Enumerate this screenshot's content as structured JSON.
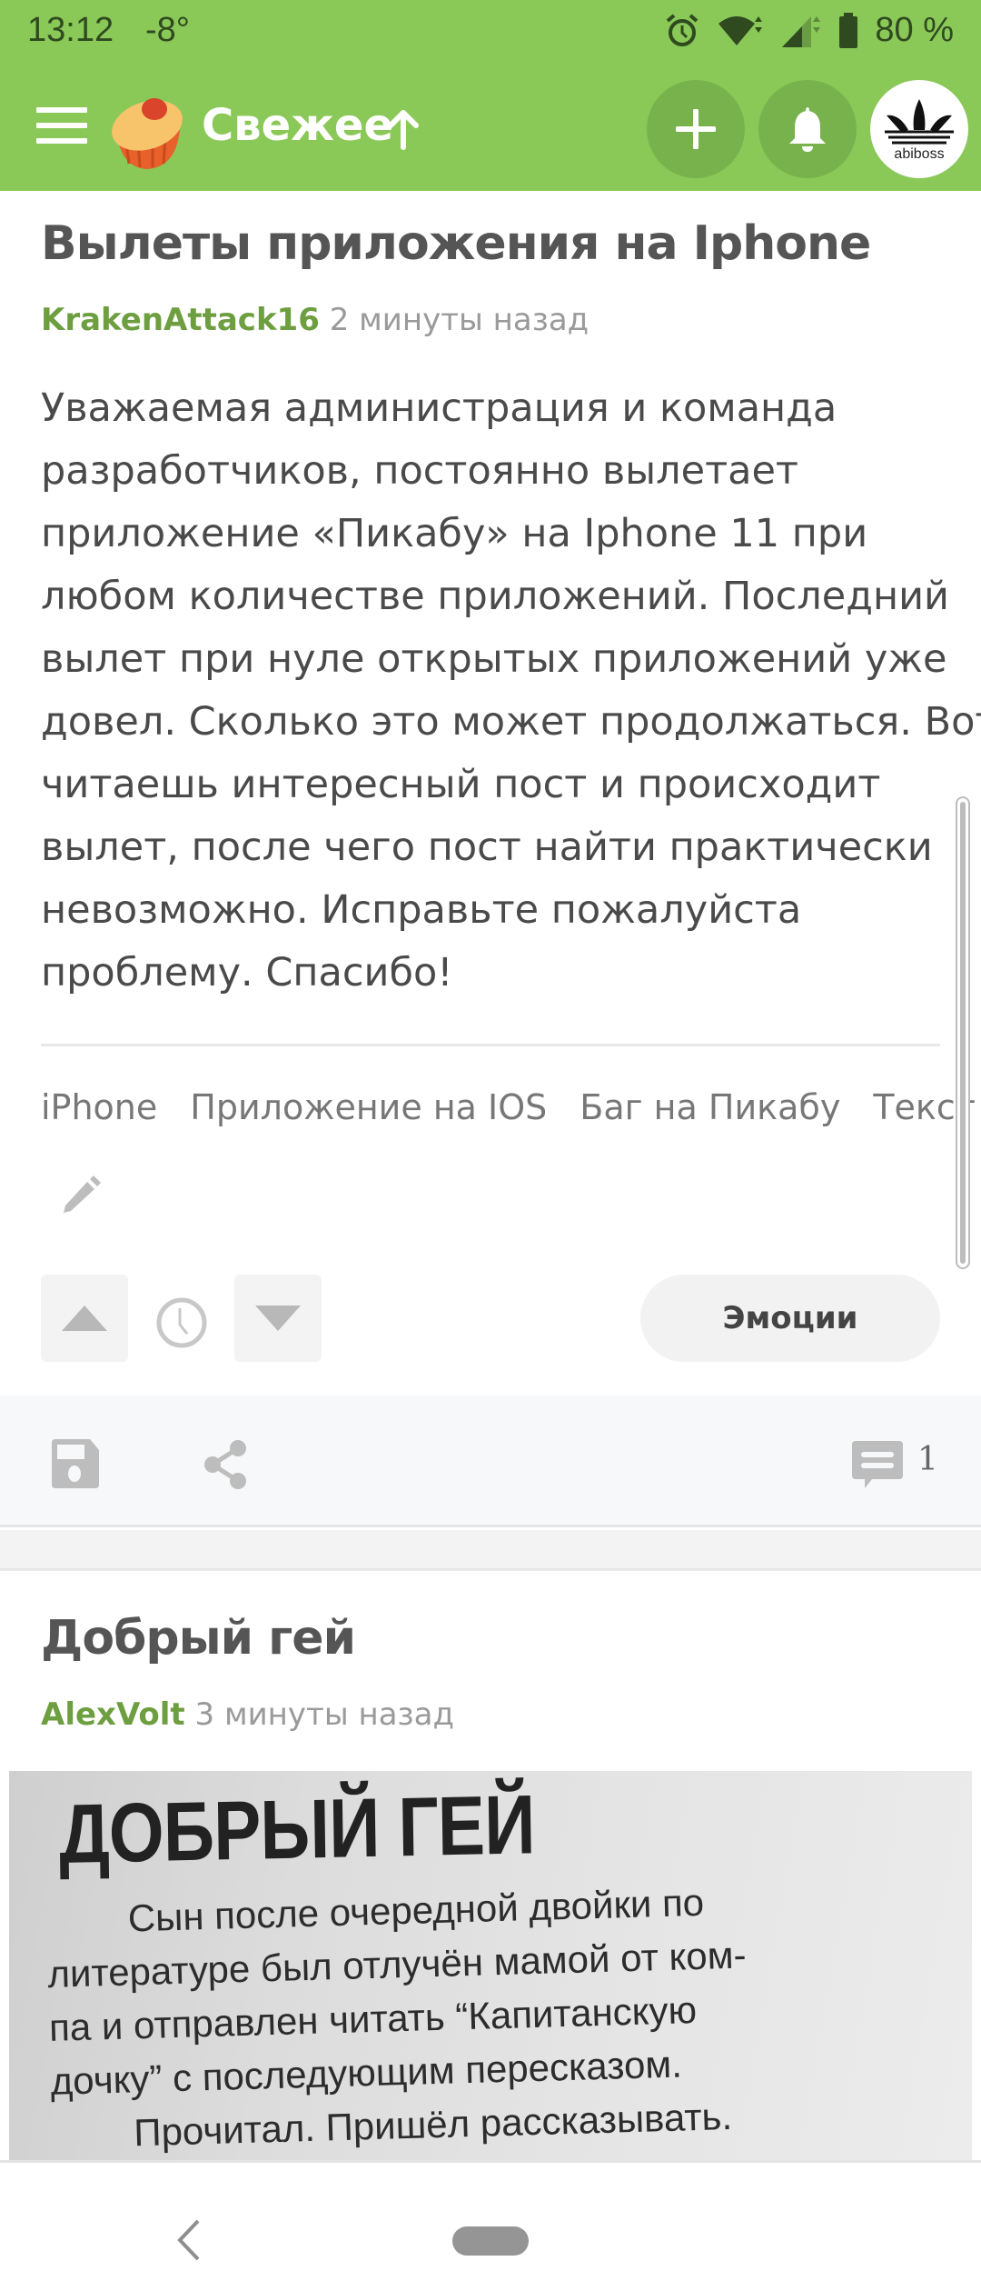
{
  "status_bar": {
    "time": "13:12",
    "temperature": "-8°",
    "battery": "80 %",
    "icons": [
      "alarm-icon",
      "wifi-icon",
      "signal-icon",
      "battery-icon"
    ]
  },
  "header": {
    "title": "Свежее",
    "brand_color": "#8ac858",
    "menu_icon": "hamburger-icon",
    "logo": "pikabu-cupcake-logo",
    "sort_icon": "arrow-up-icon",
    "add_icon": "plus-icon",
    "notifications_icon": "bell-icon",
    "avatar_label": "abiboss"
  },
  "posts": [
    {
      "title": "Вылеты приложения на Iphone",
      "author": "KrakenAttack16",
      "time_ago": "2 минуты назад",
      "body_lines": [
        "Уважаемая администрация и команда",
        "разработчиков, постоянно вылетает",
        "приложение «Пикабу» на Iphone 11 при",
        "любом количестве приложений. Последний",
        "вылет при нуле открытых приложений уже",
        "довел. Сколько это может продолжаться. Вот",
        "читаешь интересный пост и происходит",
        "вылет, после чего пост найти практически",
        "невозможно. Исправьте пожалуйста",
        "проблему. Спасибо!"
      ],
      "tags": [
        "iPhone",
        "Приложение на IOS",
        "Баг на Пикабу",
        "Текст"
      ],
      "emotions_label": "Эмоции",
      "comment_count": "1"
    },
    {
      "title": "Добрый гей",
      "author": "AlexVolt",
      "time_ago": "3 минуты назад",
      "image": {
        "headline": "ДОБРЫЙ ГЕЙ",
        "lines": [
          "Сын после очередной двойки по",
          "литературе был отлучён мамой от ком-",
          "па и отправлен читать “Капитанскую",
          "дочку” с последующим пересказом.",
          "Прочитал. Пришёл рассказывать."
        ]
      }
    }
  ],
  "colors": {
    "author_green": "#6d9e3f",
    "header_button": "#78b24c"
  }
}
